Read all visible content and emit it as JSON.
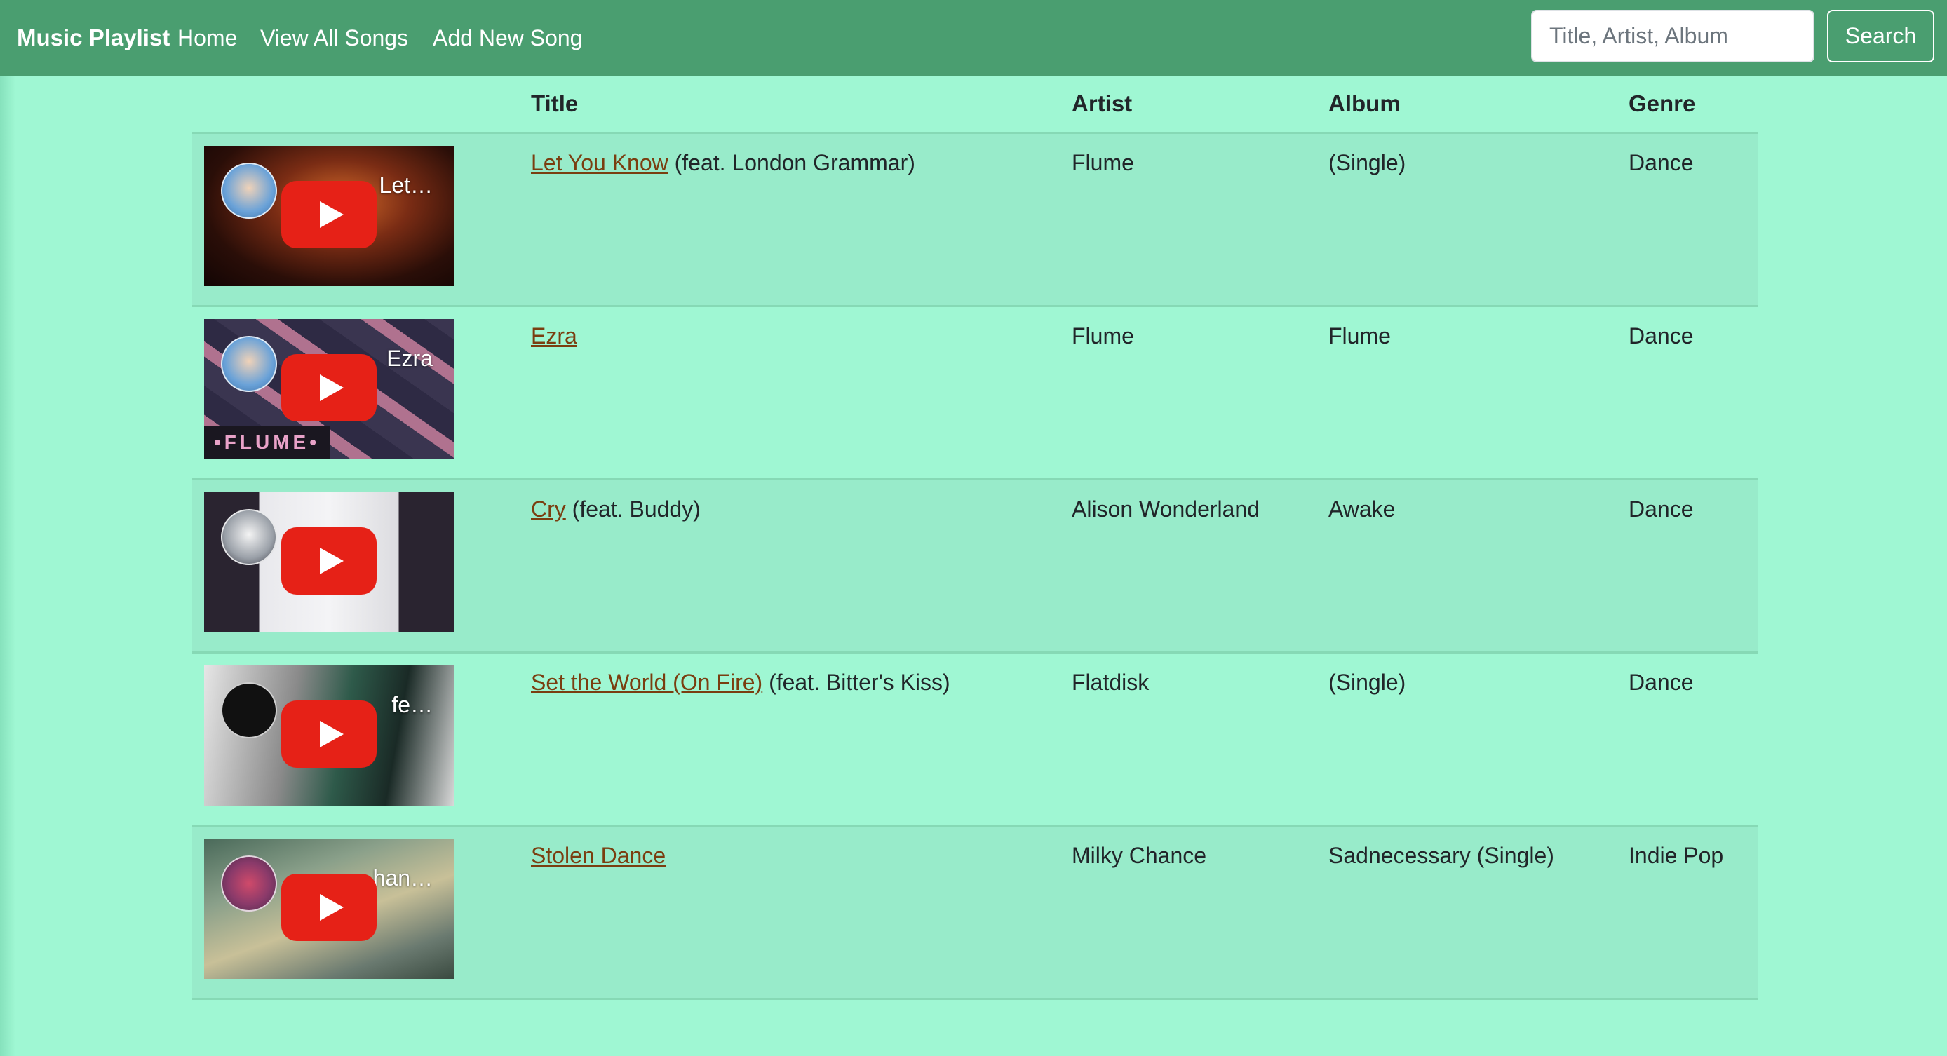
{
  "navbar": {
    "brand": "Music Playlist",
    "links": [
      "Home",
      "View All Songs",
      "Add New Song"
    ],
    "search_placeholder": "Title, Artist, Album",
    "search_value": "",
    "search_button": "Search",
    "background_color": "#4a9e70"
  },
  "page": {
    "background_color": "#9ff7d3",
    "link_color": "#7a3e10"
  },
  "table": {
    "headers": [
      "",
      "Title",
      "Artist",
      "Album",
      "Genre"
    ],
    "rows": [
      {
        "thumb_title": "Let…",
        "thumb_icon": "youtube-play-icon",
        "title_link": "Let You Know",
        "title_extra": " (feat. London Grammar)",
        "artist": "Flume",
        "album": "(Single)",
        "genre": "Dance"
      },
      {
        "thumb_title": "Ezra",
        "thumb_badge": "•FLUME•",
        "thumb_icon": "youtube-play-icon",
        "title_link": "Ezra",
        "title_extra": "",
        "artist": "Flume",
        "album": "Flume",
        "genre": "Dance"
      },
      {
        "thumb_title": "",
        "thumb_icon": "youtube-play-icon",
        "title_link": "Cry",
        "title_extra": " (feat. Buddy)",
        "artist": "Alison Wonderland",
        "album": "Awake",
        "genre": "Dance"
      },
      {
        "thumb_title": "fe…",
        "thumb_icon": "youtube-play-icon",
        "title_link": "Set the World (On Fire)",
        "title_extra": " (feat. Bitter's Kiss)",
        "artist": "Flatdisk",
        "album": "(Single)",
        "genre": "Dance"
      },
      {
        "thumb_title": "han…",
        "thumb_icon": "youtube-play-icon",
        "title_link": "Stolen Dance",
        "title_extra": "",
        "artist": "Milky Chance",
        "album": "Sadnecessary (Single)",
        "genre": "Indie Pop"
      }
    ]
  }
}
